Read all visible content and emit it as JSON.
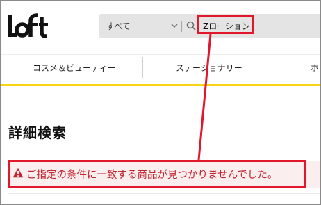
{
  "header": {
    "logo_text": "LOFT",
    "search": {
      "category_selected": "すべて",
      "query_value": "Zローション"
    }
  },
  "nav": {
    "items": [
      {
        "label": "コスメ＆ビューティー"
      },
      {
        "label": "ステーショナリー"
      },
      {
        "label": "ホーム"
      }
    ]
  },
  "main": {
    "title": "詳細検索",
    "alert_message": "ご指定の条件に一致する商品が見つかりませんでした。"
  },
  "colors": {
    "accent_yellow": "#f6d612",
    "annotation_red": "#e1182c",
    "alert_text": "#c4232f",
    "alert_bg": "#fbeeee"
  },
  "icons": {
    "search": "search-icon",
    "dropdown": "chevron-down-icon",
    "warning": "warning-icon"
  }
}
